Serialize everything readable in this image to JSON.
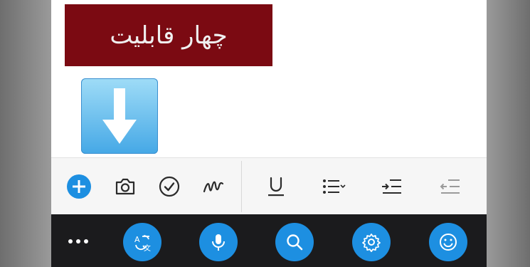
{
  "banner": {
    "title": "چهار قابلیت"
  },
  "colors": {
    "banner_bg": "#7b0a12",
    "accent_blue": "#1d8fe1",
    "toolbar_bg": "#f6f6f6",
    "bottom_bar_bg": "#1b1b1d",
    "icon_dark": "#2b2b2b",
    "icon_disabled": "#9a9a9a"
  },
  "arrow_tile": {
    "icon": "down-arrow-icon"
  },
  "format_toolbar": {
    "items": [
      {
        "icon": "add-icon",
        "state": "active"
      },
      {
        "icon": "camera-icon"
      },
      {
        "icon": "checkmark-circle-icon"
      },
      {
        "icon": "scribble-icon"
      },
      {
        "icon": "underline-icon"
      },
      {
        "icon": "bullet-list-icon"
      },
      {
        "icon": "indent-icon"
      },
      {
        "icon": "outdent-icon",
        "state": "disabled"
      }
    ]
  },
  "bottom_bar": {
    "items": [
      {
        "icon": "more-icon"
      },
      {
        "icon": "translate-icon"
      },
      {
        "icon": "microphone-icon"
      },
      {
        "icon": "search-icon"
      },
      {
        "icon": "settings-gear-icon"
      },
      {
        "icon": "emoji-icon"
      }
    ]
  }
}
